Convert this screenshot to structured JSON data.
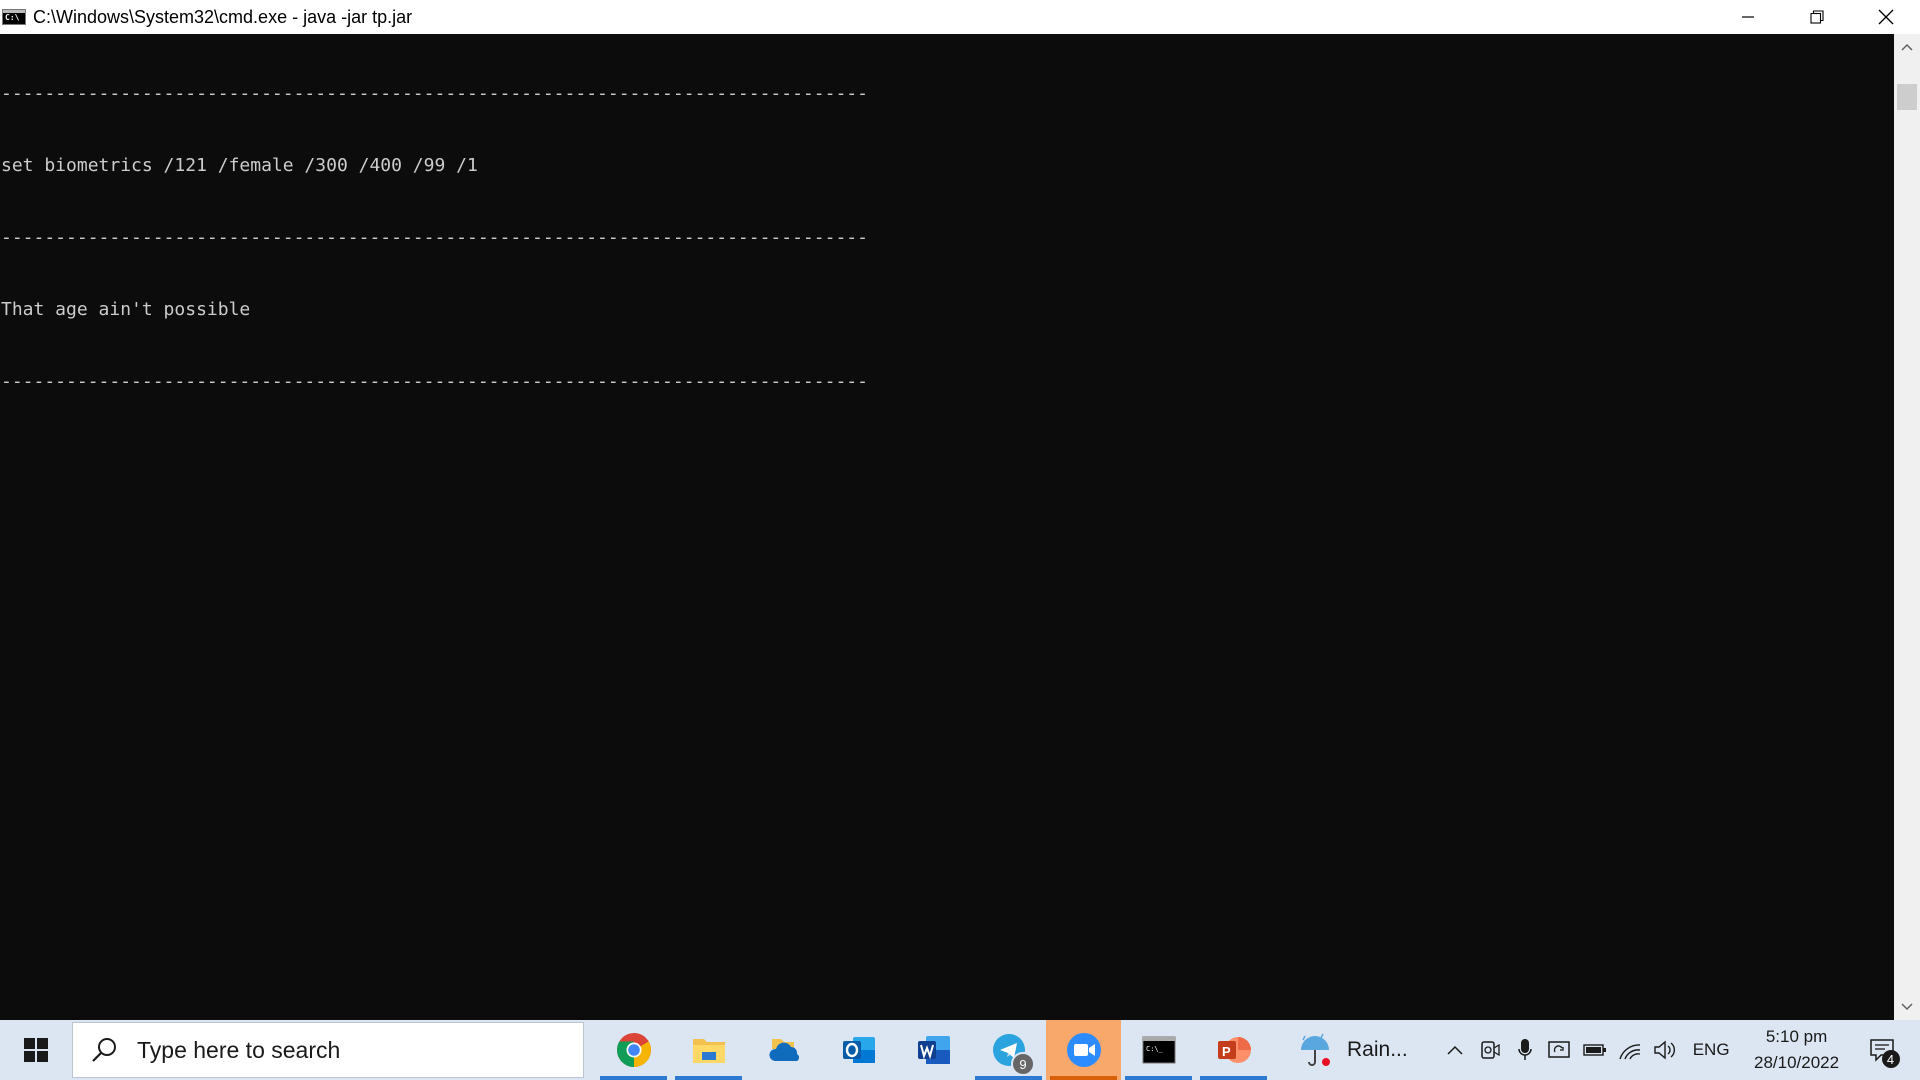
{
  "window": {
    "title": "C:\\Windows\\System32\\cmd.exe - java  -jar tp.jar",
    "icon_text": "C:\\",
    "buttons": [
      "minimize-icon",
      "restore-icon",
      "close-icon"
    ]
  },
  "console": {
    "lines": [
      "--------------------------------------------------------------------------------",
      "set biometrics /121 /female /300 /400 /99 /1",
      "--------------------------------------------------------------------------------",
      "That age ain't possible",
      "--------------------------------------------------------------------------------"
    ],
    "colors": {
      "background": "#0c0c0c",
      "text": "#cccccc"
    }
  },
  "scrollbar": {
    "icons": [
      "chevron-up-icon",
      "chevron-down-icon"
    ]
  },
  "taskbar": {
    "search_placeholder": "Type here to search",
    "apps": [
      {
        "icon": "chrome-icon",
        "running": true
      },
      {
        "icon": "file-explorer-icon",
        "running": true
      },
      {
        "icon": "onedrive-icon",
        "running": false
      },
      {
        "icon": "outlook-icon",
        "running": false
      },
      {
        "icon": "word-icon",
        "running": false
      },
      {
        "icon": "telegram-icon",
        "running": true,
        "badge": "9"
      },
      {
        "icon": "zoom-icon",
        "running": true,
        "active": true
      },
      {
        "icon": "cmd-icon",
        "running": true
      },
      {
        "icon": "powerpoint-icon",
        "running": true
      }
    ],
    "weather_label": "Rain...",
    "language": "ENG",
    "time": "5:10 pm",
    "date": "28/10/2022",
    "notification_count": "4"
  }
}
